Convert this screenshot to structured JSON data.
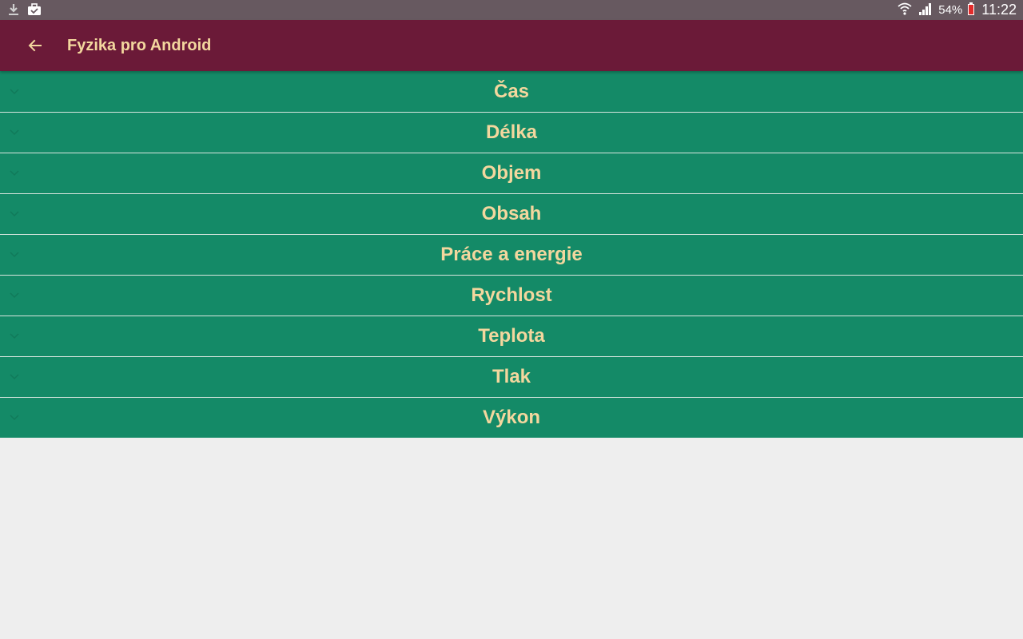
{
  "status_bar": {
    "icons_left": [
      "download-icon",
      "briefcase-icon"
    ],
    "icons_right": [
      "wifi-icon",
      "signal-icon",
      "battery-icon"
    ],
    "battery": "54%",
    "time": "11:22"
  },
  "app_bar": {
    "back_icon": "arrow-back-icon",
    "title": "Fyzika pro Android"
  },
  "colors": {
    "status_bar": "#675960",
    "app_bar": "#6b1a38",
    "accent_text": "#f3d79e",
    "list_item": "#148a67",
    "background": "#eeeeee"
  },
  "list": {
    "items": [
      {
        "label": "Čas"
      },
      {
        "label": "Délka"
      },
      {
        "label": "Objem"
      },
      {
        "label": "Obsah"
      },
      {
        "label": "Práce a energie"
      },
      {
        "label": "Rychlost"
      },
      {
        "label": "Teplota"
      },
      {
        "label": "Tlak"
      },
      {
        "label": "Výkon"
      }
    ]
  }
}
